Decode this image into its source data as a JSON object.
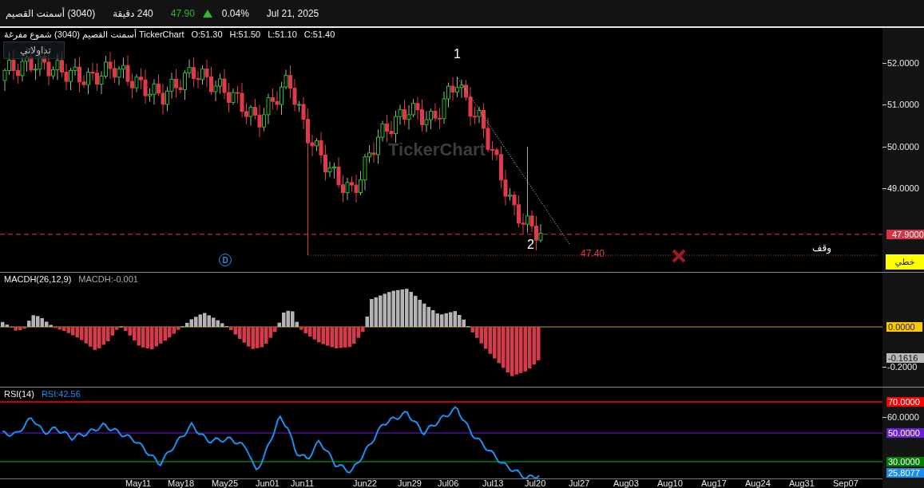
{
  "header": {
    "name": "أسمنت القصيم",
    "code": "(3040)",
    "interval_value": "240",
    "interval_unit": "دقيقة",
    "price": "47.90",
    "change": "0.04%",
    "date": "Jul 21, 2025"
  },
  "price_pane": {
    "title": "TickerChart أسمنت القصيم  (3040)  شموع مفرغة",
    "ohlc": [
      "O:51.30",
      "H:51.50",
      "L:51.10",
      "C:51.40"
    ],
    "watermark": "TickerChart",
    "portfolio_button": "تداولاتي",
    "wave_labels": [
      "1",
      "2"
    ],
    "stop_value": "47.40",
    "stop_label": "وقف",
    "event_marker": "D",
    "ticks": [
      "52.0000",
      "51.0000",
      "50.0000",
      "49.0000"
    ],
    "last_price": "47.9000",
    "scale_button": "خطي"
  },
  "macd_pane": {
    "title": "MACDH(26,12,9)",
    "value": "MACDH:-0.001",
    "ticks": [
      "-0.2000"
    ],
    "zero_badge": "0.0000",
    "last_badge": "-0.1616"
  },
  "rsi_pane": {
    "title": "RSI(14)",
    "value": "RSI:42.56",
    "ticks": [
      "60.0000"
    ],
    "levels": [
      {
        "label": "70.0000",
        "color": "#ff0000"
      },
      {
        "label": "50.0000",
        "color": "#6a1fd0"
      },
      {
        "label": "30.0000",
        "color": "#008000"
      }
    ],
    "last_badge": "25.8077"
  },
  "time_axis": [
    "May11",
    "May18",
    "May25",
    "Jun01",
    "Jun11",
    "Jun22",
    "Jun29",
    "Jul06",
    "Jul13",
    "Jul20",
    "Jul27",
    "Aug03",
    "Aug10",
    "Aug17",
    "Aug24",
    "Aug31",
    "Sep07"
  ]
}
